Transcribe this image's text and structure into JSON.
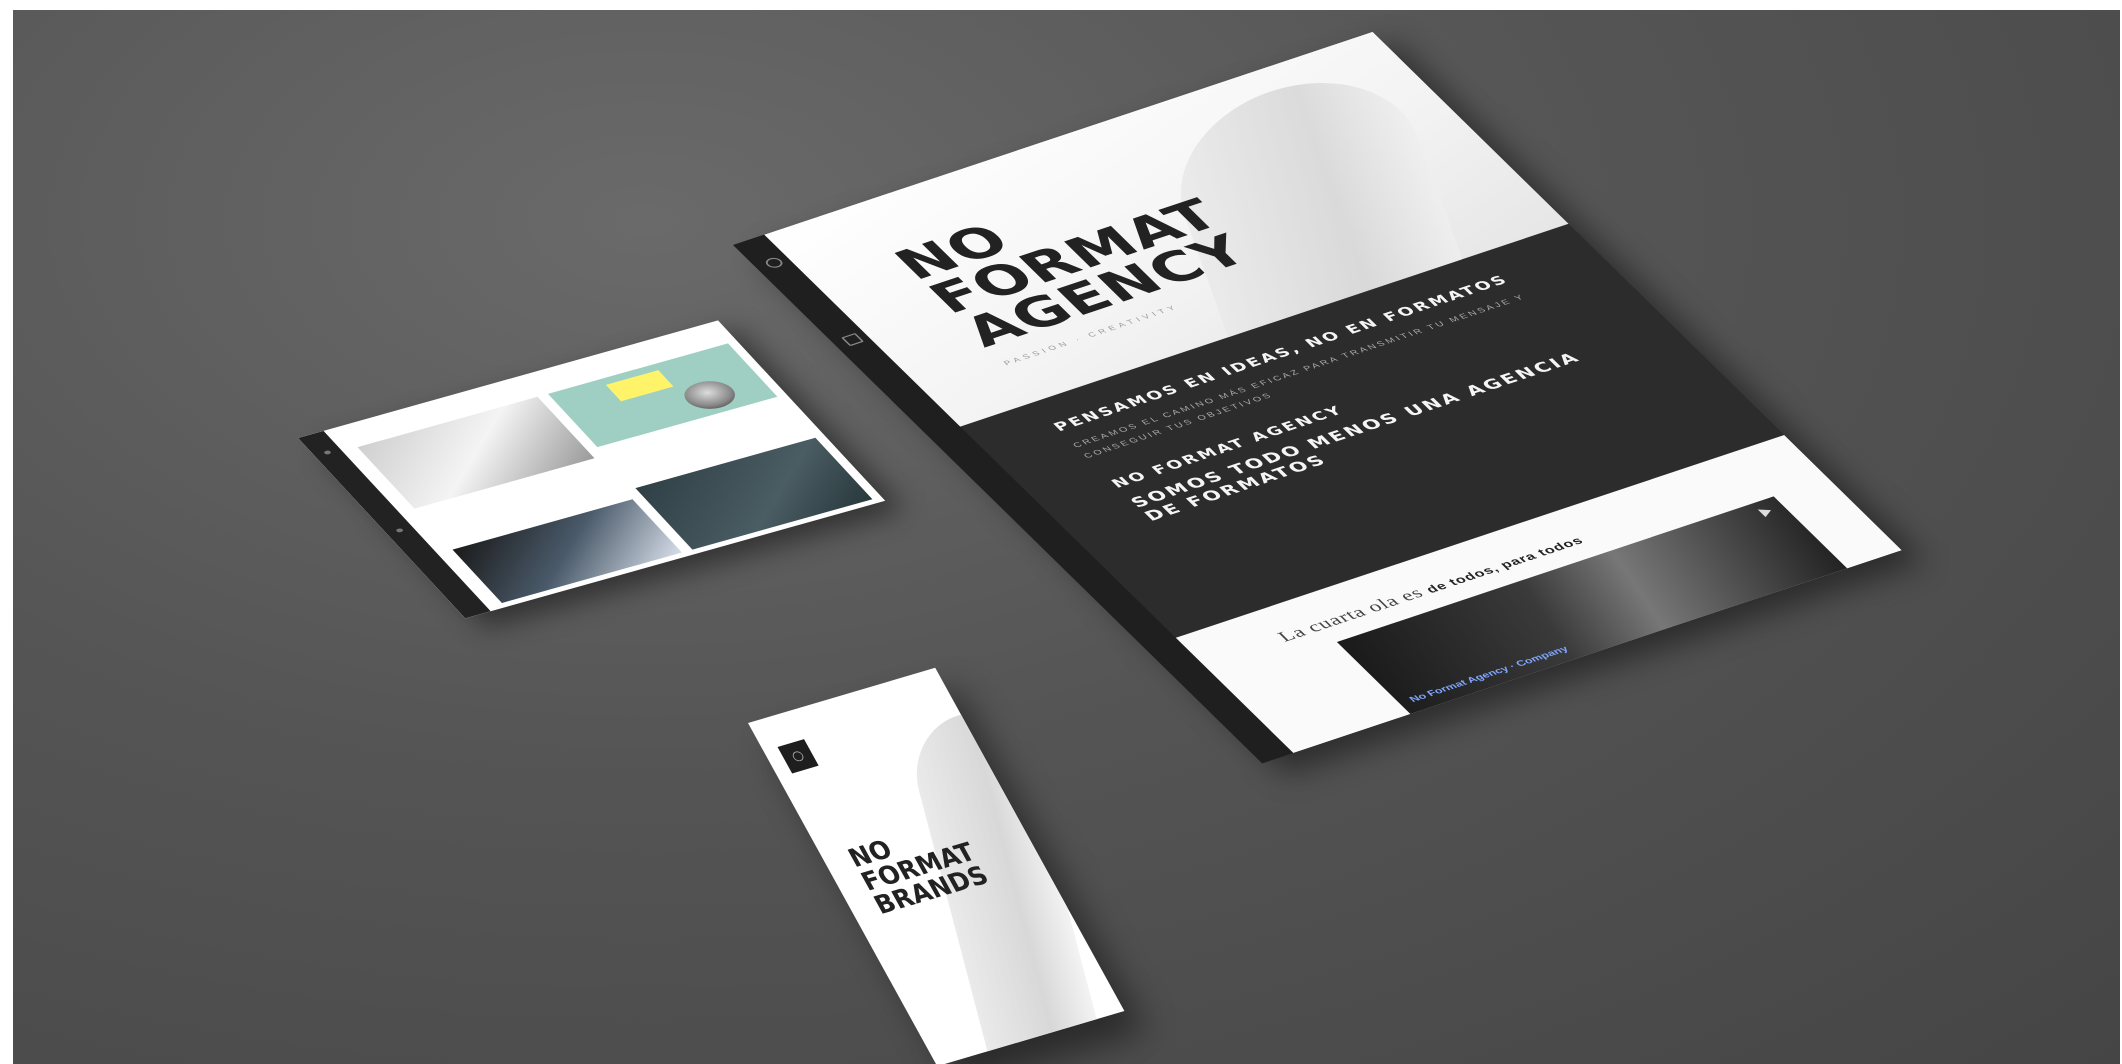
{
  "desktop": {
    "hero_title_line1": "NO",
    "hero_title_line2": "FORMAT",
    "hero_title_line3": "AGENCY",
    "hero_subtitle": "PASSION · CREATIVITY",
    "section1_title": "PENSAMOS EN IDEAS, NO EN FORMATOS",
    "section1_body": "CREAMOS EL CAMINO MÁS EFICAZ PARA TRANSMITIR TU MENSAJE Y CONSEGUIR TUS OBJETIVOS",
    "section1_small": "",
    "section2_title": "NO FORMAT AGENCY",
    "section2_body": "",
    "section3_title": "SOMOS TODO MENOS UNA AGENCIA DE FORMATOS",
    "video_heading_serif": "La cuarta ola es",
    "video_heading_bold": "de todos, para todos",
    "video_caption": "No Format Agency · Company",
    "rail_text": ""
  },
  "tablet": {
    "title": "",
    "card1_category": "",
    "card1_headline": "",
    "card1_excerpt": "",
    "card2_category": "",
    "card2_headline": "",
    "card2_excerpt": "",
    "card2_excerpt_highlight": ""
  },
  "phone": {
    "title_line1": "NO",
    "title_line2": "FORMAT",
    "title_line3": "BRANDS",
    "subtitle": ""
  },
  "colors": {
    "background": "#555555",
    "dark_panel": "#2c2c2c",
    "light_panel": "#ffffff",
    "accent_teal": "#9ecfc2",
    "accent_yellow": "#fff36a",
    "link_blue": "#7fa6ff"
  }
}
